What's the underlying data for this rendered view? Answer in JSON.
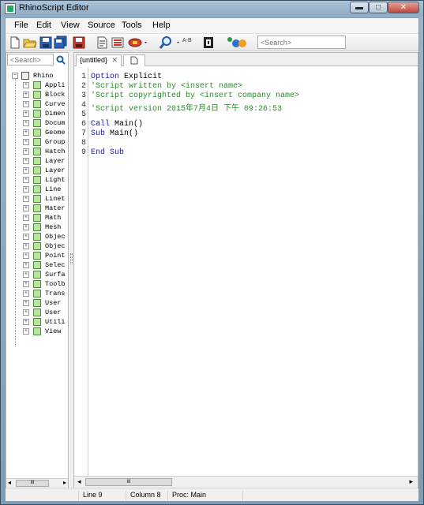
{
  "window": {
    "title": "RhinoScript Editor",
    "controls": {
      "minimize": "▬",
      "maximize": "□",
      "close": "✕"
    }
  },
  "menu": [
    "File",
    "Edit",
    "View",
    "Source",
    "Tools",
    "Help"
  ],
  "toolbar": {
    "search_placeholder": "<Search>",
    "replace_label": "A-B"
  },
  "left_panel": {
    "search_placeholder": "<Search>",
    "root": "Rhino",
    "items": [
      "Appli",
      "Block",
      "Curve",
      "Dimen",
      "Docum",
      "Geome",
      "Group",
      "Hatch",
      "Layer",
      "Layer",
      "Light",
      "Line",
      "Linet",
      "Mater",
      "Math",
      "Mesh",
      "Objec",
      "Objec",
      "Point",
      "Selec",
      "Surfa",
      "Toolb",
      "Trans",
      "User",
      "User",
      "Utili",
      "View"
    ],
    "scroll_grip": "III"
  },
  "tabs": [
    {
      "label": "{untitled}",
      "close": "✕"
    }
  ],
  "code_lines": [
    {
      "n": "1",
      "parts": [
        {
          "t": "Option",
          "c": "kw"
        },
        {
          "t": " Explicit",
          "c": ""
        }
      ]
    },
    {
      "n": "2",
      "parts": [
        {
          "t": "'Script written by <insert name>",
          "c": "cm"
        }
      ]
    },
    {
      "n": "3",
      "parts": [
        {
          "t": "'Script copyrighted by <insert company name>",
          "c": "cm"
        }
      ]
    },
    {
      "n": "4",
      "parts": [
        {
          "t": "'Script version 2015年7月4日 下午 09:26:53",
          "c": "cm"
        }
      ]
    },
    {
      "n": "5",
      "parts": []
    },
    {
      "n": "6",
      "parts": [
        {
          "t": "Call",
          "c": "kw"
        },
        {
          "t": " Main()",
          "c": ""
        }
      ]
    },
    {
      "n": "7",
      "parts": [
        {
          "t": "Sub",
          "c": "kw"
        },
        {
          "t": " Main()",
          "c": ""
        }
      ]
    },
    {
      "n": "8",
      "parts": []
    },
    {
      "n": "9",
      "parts": [
        {
          "t": "End Sub",
          "c": "kw"
        }
      ]
    }
  ],
  "hscroll": {
    "left": "◂",
    "right": "▸",
    "grip": "III"
  },
  "status": {
    "line": "Line 9",
    "column": "Column 8",
    "proc": "Proc: Main"
  }
}
